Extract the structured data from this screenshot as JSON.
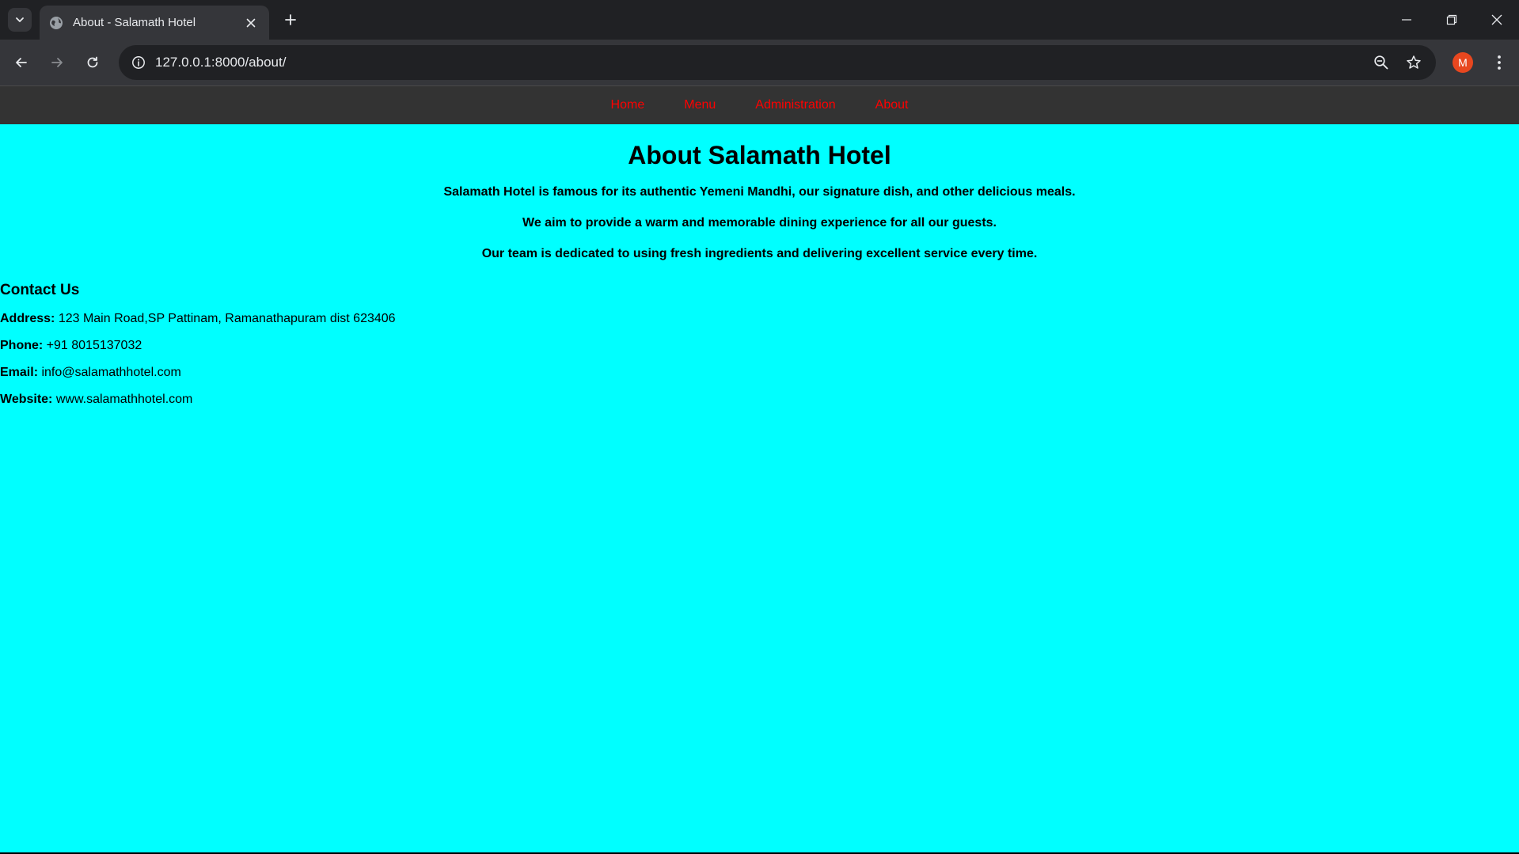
{
  "browser": {
    "tab_title": "About - Salamath Hotel",
    "url": "127.0.0.1:8000/about/",
    "avatar_letter": "M",
    "accent_color": "#e8471f"
  },
  "site": {
    "nav": [
      "Home",
      "Menu",
      "Administration",
      "About"
    ],
    "nav_color": "#ff0000",
    "background_color": "#00ffff",
    "title": "About Salamath Hotel",
    "paragraphs": [
      "Salamath Hotel is famous for its authentic Yemeni Mandhi, our signature dish, and other delicious meals.",
      "We aim to provide a warm and memorable dining experience for all our guests.",
      "Our team is dedicated to using fresh ingredients and delivering excellent service every time."
    ],
    "contact": {
      "heading": "Contact Us",
      "address_label": "Address:",
      "address": "123 Main Road,SP Pattinam, Ramanathapuram dist 623406",
      "phone_label": "Phone:",
      "phone": "+91 8015137032",
      "email_label": "Email:",
      "email": "info@salamathhotel.com",
      "website_label": "Website:",
      "website": "www.salamathhotel.com"
    }
  }
}
